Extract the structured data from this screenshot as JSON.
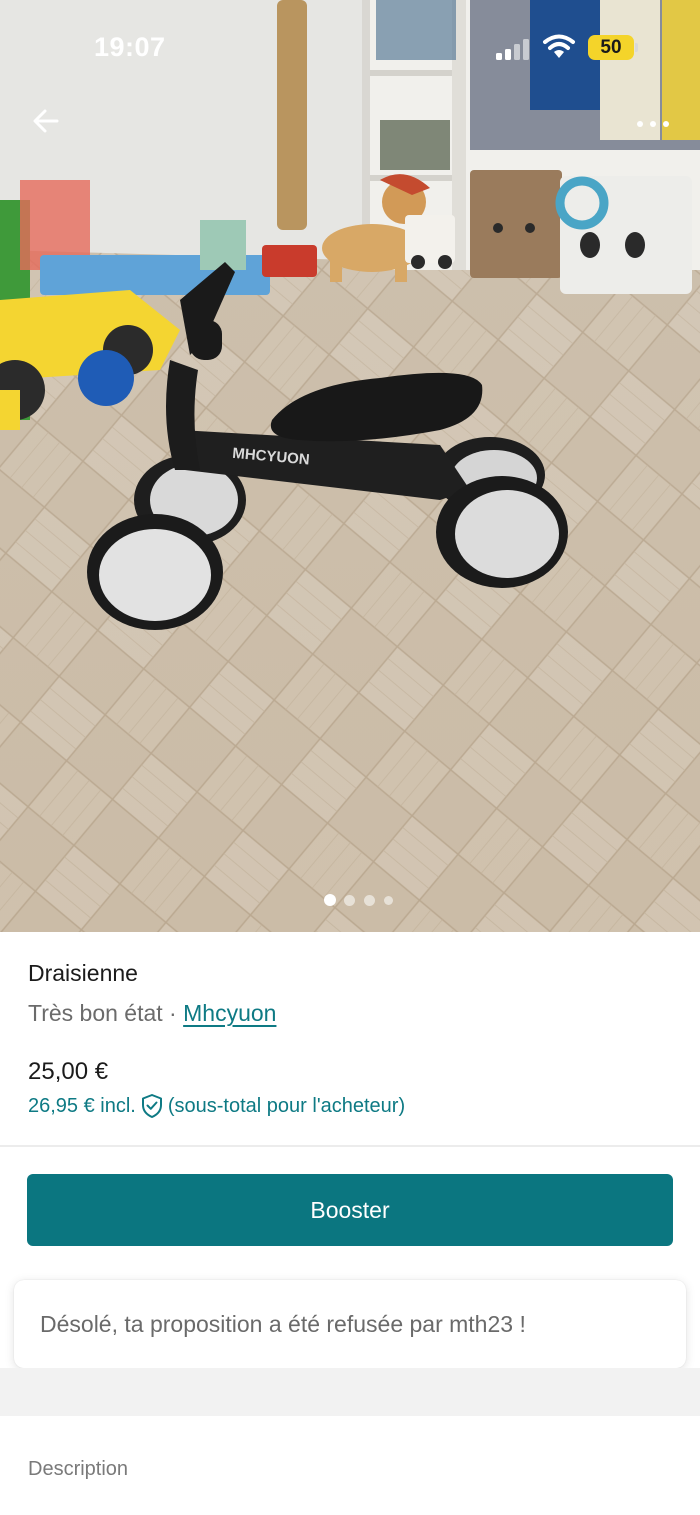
{
  "status_bar": {
    "time": "19:07",
    "battery": "50"
  },
  "photo": {
    "logo_text": "MHCYUON",
    "pager_total": 4,
    "pager_active": 0
  },
  "listing": {
    "title": "Draisienne",
    "condition": "Très bon état",
    "separator": " · ",
    "brand": "Mhcyuon",
    "price": "25,00 €",
    "price_incl": "26,95 € incl.",
    "price_incl_note": "(sous-total pour l'acheteur)"
  },
  "actions": {
    "booster_label": "Booster"
  },
  "notification": {
    "message": "Désolé, ta proposition a été refusée par mth23 !"
  },
  "sections": {
    "description_label": "Description"
  },
  "colors": {
    "accent": "#0b7680",
    "link": "#0e7a84",
    "battery": "#f4d42a"
  },
  "icons": [
    "back-arrow-icon",
    "more-options-icon",
    "shield-check-icon",
    "signal-icon",
    "wifi-icon",
    "battery-icon"
  ]
}
